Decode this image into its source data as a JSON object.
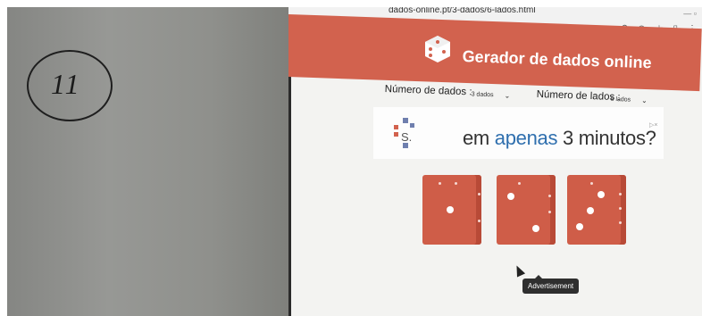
{
  "browser": {
    "url": "dados-online.pt/3-dados/6-lados.html",
    "icons": [
      "location-icon",
      "zoom-icon",
      "star-icon",
      "extensions-icon",
      "menu-icon"
    ]
  },
  "wall": {
    "handwritten": "11"
  },
  "site": {
    "title": "Gerador de dados online",
    "logo": "dice-logo-icon",
    "colors": {
      "header": "#d2624e",
      "die": "#cf5d48",
      "ad_highlight": "#2f6fae"
    }
  },
  "controls": {
    "num_dice_label": "Número de dados :",
    "num_dice_value": "3 dados",
    "num_sides_label": "Número de lados :",
    "num_sides_value": "6 lados"
  },
  "ad": {
    "text_pre": "em ",
    "text_highlight": "apenas",
    "text_post": " 3 minutos?",
    "brand_letter": "S."
  },
  "dice": [
    {
      "value": 1
    },
    {
      "value": 2
    },
    {
      "value": 3
    }
  ],
  "tooltip": {
    "text": "Advertisement"
  }
}
